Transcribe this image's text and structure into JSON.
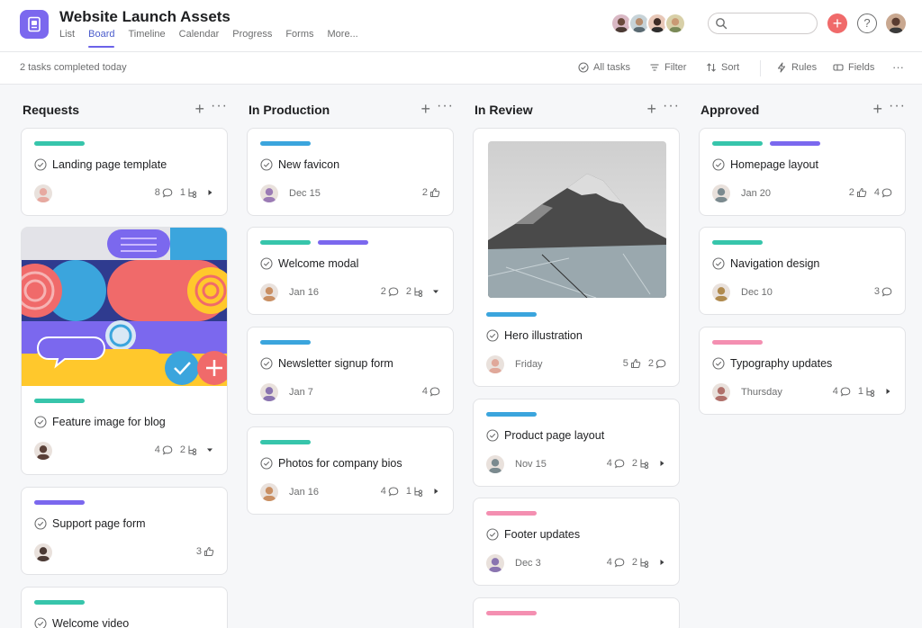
{
  "project": {
    "title": "Website Launch Assets",
    "tabs": [
      {
        "label": "List",
        "active": false
      },
      {
        "label": "Board",
        "active": true
      },
      {
        "label": "Timeline",
        "active": false
      },
      {
        "label": "Calendar",
        "active": false
      },
      {
        "label": "Progress",
        "active": false
      },
      {
        "label": "Forms",
        "active": false
      },
      {
        "label": "More...",
        "active": false
      }
    ]
  },
  "header": {
    "search_placeholder": "",
    "add_label": "+",
    "help_label": "?"
  },
  "toolbar": {
    "status": "2 tasks completed today",
    "all_tasks": "All tasks",
    "filter": "Filter",
    "sort": "Sort",
    "rules": "Rules",
    "fields": "Fields",
    "more": "···"
  },
  "colors": {
    "accent": "#6b62e8",
    "teal": "#37c5ab",
    "blue": "#3ba5dd",
    "purple": "#7b68ee",
    "pink": "#f48fb1",
    "add_button": "#f06a6a"
  },
  "columns": [
    {
      "title": "Requests",
      "cards": [
        {
          "name": "Landing page template",
          "due": "",
          "tags": [
            "#37c5ab"
          ],
          "comments": "8",
          "subtasks": "1",
          "likes": "",
          "arrow": "right",
          "avatar": "#e7a9a0"
        },
        {
          "name": "Feature image for blog",
          "due": "",
          "tags": [
            "#37c5ab"
          ],
          "comments": "4",
          "subtasks": "2",
          "likes": "",
          "arrow": "down",
          "avatar": "#5a4038"
        },
        {
          "name": "Support page form",
          "due": "",
          "tags": [
            "#7b68ee"
          ],
          "comments": "",
          "subtasks": "",
          "likes": "3",
          "arrow": "",
          "avatar": "#4b3a34"
        },
        {
          "name": "Welcome video",
          "due": "",
          "tags": [
            "#37c5ab"
          ],
          "comments": "",
          "subtasks": "",
          "likes": "",
          "arrow": "",
          "avatar": ""
        }
      ]
    },
    {
      "title": "In Production",
      "cards": [
        {
          "name": "New favicon",
          "due": "Dec 15",
          "tags": [
            "#3ba5dd"
          ],
          "comments": "",
          "subtasks": "",
          "likes": "2",
          "arrow": "",
          "avatar": "#9b7bb5"
        },
        {
          "name": "Welcome modal",
          "due": "Jan 16",
          "tags": [
            "#37c5ab",
            "#7b68ee"
          ],
          "comments": "2",
          "subtasks": "2",
          "likes": "",
          "arrow": "down",
          "avatar": "#c98f63"
        },
        {
          "name": "Newsletter signup form",
          "due": "Jan 7",
          "tags": [
            "#3ba5dd"
          ],
          "comments": "4",
          "subtasks": "",
          "likes": "",
          "arrow": "",
          "avatar": "#8a74b0"
        },
        {
          "name": "Photos for company bios",
          "due": "Jan 16",
          "tags": [
            "#37c5ab"
          ],
          "comments": "4",
          "subtasks": "1",
          "likes": "",
          "arrow": "right",
          "avatar": "#c98f63"
        }
      ]
    },
    {
      "title": "In Review",
      "cards": [
        {
          "name": "Hero illustration",
          "due": "Friday",
          "tags": [
            "#3ba5dd"
          ],
          "comments": "2",
          "subtasks": "",
          "likes": "5",
          "arrow": "",
          "avatar": "#e0a89a"
        },
        {
          "name": "Product page layout",
          "due": "Nov 15",
          "tags": [
            "#3ba5dd"
          ],
          "comments": "4",
          "subtasks": "2",
          "likes": "",
          "arrow": "right",
          "avatar": "#7b8a8f"
        },
        {
          "name": "Footer updates",
          "due": "Dec 3",
          "tags": [
            "#f48fb1"
          ],
          "comments": "4",
          "subtasks": "2",
          "likes": "",
          "arrow": "right",
          "avatar": "#8a74b0"
        },
        {
          "name": "",
          "due": "",
          "tags": [
            "#f48fb1"
          ],
          "comments": "",
          "subtasks": "",
          "likes": "",
          "arrow": "",
          "avatar": ""
        }
      ]
    },
    {
      "title": "Approved",
      "cards": [
        {
          "name": "Homepage layout",
          "due": "Jan 20",
          "tags": [
            "#37c5ab",
            "#7b68ee"
          ],
          "comments": "4",
          "subtasks": "",
          "likes": "2",
          "arrow": "",
          "avatar": "#7b8a8f"
        },
        {
          "name": "Navigation design",
          "due": "Dec 10",
          "tags": [
            "#37c5ab"
          ],
          "comments": "3",
          "subtasks": "",
          "likes": "",
          "arrow": "",
          "avatar": "#b08a4e"
        },
        {
          "name": "Typography updates",
          "due": "Thursday",
          "tags": [
            "#f48fb1"
          ],
          "comments": "4",
          "subtasks": "1",
          "likes": "",
          "arrow": "right",
          "avatar": "#b0706a"
        }
      ]
    }
  ]
}
